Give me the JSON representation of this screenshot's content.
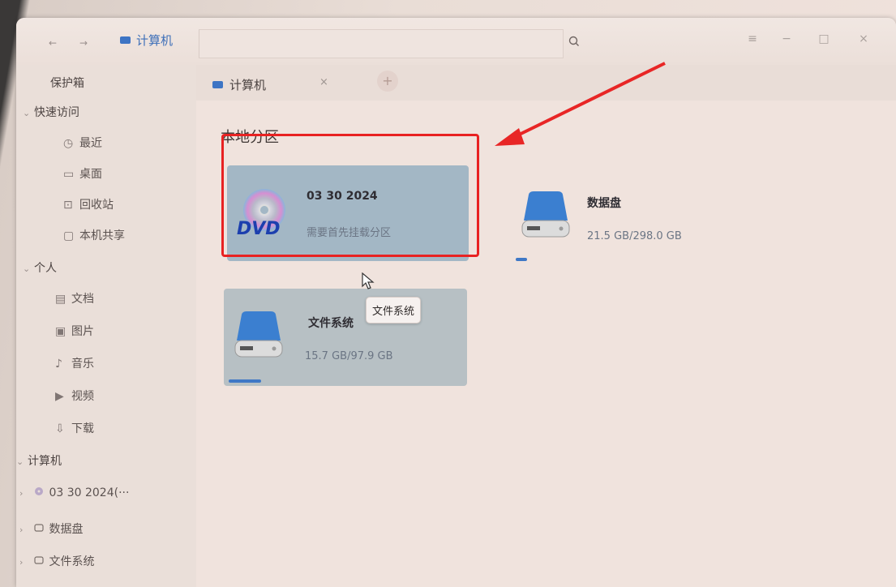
{
  "window": {
    "breadcrumb": "计算机",
    "nav_back": "←",
    "nav_forward": "→",
    "search_icon": "search-icon",
    "controls": {
      "menu": "≡",
      "minimize": "−",
      "maximize": "□",
      "close": "×"
    }
  },
  "sidebar": {
    "vault": "保护箱",
    "quick_access": {
      "label": "快速访问",
      "items": [
        {
          "icon": "clock-icon",
          "glyph": "◷",
          "label": "最近"
        },
        {
          "icon": "desktop-icon",
          "glyph": "▭",
          "label": "桌面"
        },
        {
          "icon": "trash-icon",
          "glyph": "⊡",
          "label": "回收站"
        },
        {
          "icon": "folder-share-icon",
          "glyph": "▢",
          "label": "本机共享"
        }
      ]
    },
    "personal": {
      "label": "个人",
      "items": [
        {
          "icon": "document-icon",
          "glyph": "▤",
          "label": "文档"
        },
        {
          "icon": "picture-icon",
          "glyph": "▣",
          "label": "图片"
        },
        {
          "icon": "music-icon",
          "glyph": "♪",
          "label": "音乐"
        },
        {
          "icon": "video-icon",
          "glyph": "▶",
          "label": "视频"
        },
        {
          "icon": "download-icon",
          "glyph": "⇩",
          "label": "下载"
        }
      ]
    },
    "computer": {
      "label": "计算机",
      "items": [
        {
          "icon": "dvd-icon",
          "label": "03 30 2024(···"
        },
        {
          "icon": "disk-icon",
          "label": "数据盘"
        },
        {
          "icon": "disk-icon",
          "label": "文件系统"
        }
      ]
    }
  },
  "tabs": [
    {
      "label": "计算机",
      "close": "×"
    }
  ],
  "tab_add": "+",
  "main": {
    "section_title": "本地分区",
    "partitions": [
      {
        "name": "03 30 2024",
        "subtitle": "需要首先挂载分区",
        "icon": "dvd-icon",
        "badge": "DVD"
      },
      {
        "name": "数据盘",
        "subtitle": "21.5 GB/298.0 GB",
        "icon": "hard-drive-icon",
        "usage": 0.07
      },
      {
        "name": "文件系统",
        "subtitle": "15.7 GB/97.9 GB",
        "icon": "hard-drive-icon",
        "usage": 0.16
      }
    ],
    "tooltip": "文件系统"
  },
  "colors": {
    "highlight": "#e82222",
    "accent": "#3f78c6"
  }
}
